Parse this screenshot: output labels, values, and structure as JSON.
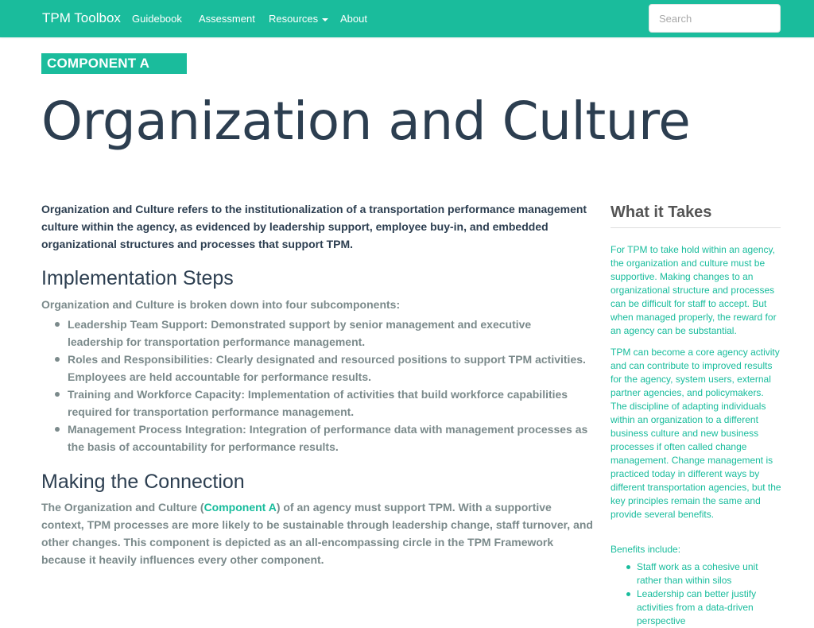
{
  "nav": {
    "brand": "TPM Toolbox",
    "links": [
      "Guidebook",
      "Assessment",
      "Resources",
      "About"
    ],
    "search_placeholder": "Search"
  },
  "main": {
    "badge": "COMPONENT A",
    "title": "Organization and Culture",
    "intro": "Organization and Culture refers to the institutionalization of a transportation performance management culture within the agency, as evidenced by leadership support, employee buy-in, and embedded organizational structures and processes that support TPM.",
    "implementation": {
      "heading": "Implementation Steps",
      "lead": "Organization and Culture is broken down into four subcomponents:",
      "items": [
        "Leadership Team Support: Demonstrated support by senior management and executive leadership for transportation performance management.",
        "Roles and Responsibilities: Clearly designated and resourced positions to support TPM activities. Employees are held accountable for performance results.",
        "Training and Workforce Capacity: Implementation of activities that build workforce capabilities required for transportation performance management.",
        "Management Process Integration: Integration of performance data with management processes as the basis of accountability for performance results."
      ]
    },
    "connection": {
      "heading": "Making the Connection",
      "text_before": "The Organization and Culture (",
      "link": "Component A",
      "text_after": ") of an agency must support TPM. With a supportive context, TPM processes are more likely to be sustainable through leadership change, staff turnover, and other changes. This component is depicted as an all-encompassing circle in the TPM Framework because it heavily influences every other component."
    }
  },
  "sidebar": {
    "title": "What it Takes",
    "p1": "For TPM to take hold within an agency, the organization and culture must be supportive. Making changes to an organizational structure and processes can be difficult for staff to accept. But when managed properly, the reward for an agency can be substantial.",
    "p2": "TPM can become a core agency activity and can contribute to improved results for the agency, system users, external partner agencies, and policymakers. The discipline of adapting individuals within an organization to a different business culture and new business processes if often called change management. Change management is practiced today in different ways by different transportation agencies, but the key principles remain the same and provide several benefits.",
    "benefits_label": "Benefits include:",
    "benefits": [
      "Staff work as a cohesive unit rather than within silos",
      "Leadership can better justify activities from a data-driven perspective"
    ]
  }
}
